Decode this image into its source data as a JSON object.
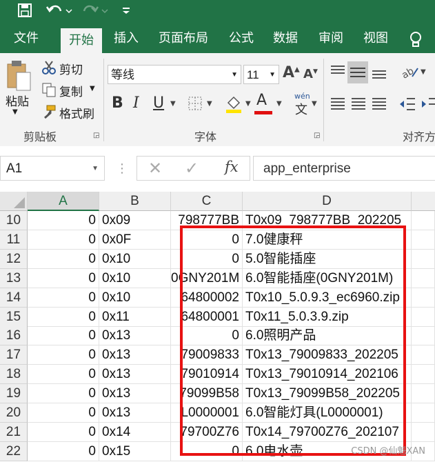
{
  "qat": {
    "save_icon": "save-icon",
    "undo_icon": "undo-icon",
    "redo_icon": "redo-icon"
  },
  "tabs": [
    "文件",
    "开始",
    "插入",
    "页面布局",
    "公式",
    "数据",
    "审阅",
    "视图"
  ],
  "active_tab": "开始",
  "ribbon": {
    "paste": "粘贴",
    "cut": "剪切",
    "copy": "复制",
    "format_painter": "格式刷",
    "clipboard_group": "剪贴板",
    "font_name": "等线",
    "font_size": "11",
    "font_group": "字体",
    "align_group": "对齐方",
    "phonetic": "wén"
  },
  "formula_bar": {
    "name_box": "A1",
    "formula": "app_enterprise",
    "fx": "fx"
  },
  "columns": [
    "A",
    "B",
    "C",
    "D"
  ],
  "rows": [
    {
      "n": "10",
      "a": "0",
      "b": "0x09",
      "c": "798777BB",
      "d": "T0x09_798777BB_202205"
    },
    {
      "n": "11",
      "a": "0",
      "b": "0x0F",
      "c": "0",
      "d": "7.0健康秤"
    },
    {
      "n": "12",
      "a": "0",
      "b": "0x10",
      "c": "0",
      "d": "5.0智能插座"
    },
    {
      "n": "13",
      "a": "0",
      "b": "0x10",
      "c": "0GNY201M",
      "d": "6.0智能插座(0GNY201M)"
    },
    {
      "n": "14",
      "a": "0",
      "b": "0x10",
      "c": "64800002",
      "d": "T0x10_5.0.9.3_ec6960.zip"
    },
    {
      "n": "15",
      "a": "0",
      "b": "0x11",
      "c": "64800001",
      "d": "T0x11_5.0.3.9.zip"
    },
    {
      "n": "16",
      "a": "0",
      "b": "0x13",
      "c": "0",
      "d": "6.0照明产品"
    },
    {
      "n": "17",
      "a": "0",
      "b": "0x13",
      "c": "79009833",
      "d": "T0x13_79009833_202205"
    },
    {
      "n": "18",
      "a": "0",
      "b": "0x13",
      "c": "79010914",
      "d": "T0x13_79010914_202106"
    },
    {
      "n": "19",
      "a": "0",
      "b": "0x13",
      "c": "79099B58",
      "d": "T0x13_79099B58_202205"
    },
    {
      "n": "20",
      "a": "0",
      "b": "0x13",
      "c": "L0000001",
      "d": "6.0智能灯具(L0000001)"
    },
    {
      "n": "21",
      "a": "0",
      "b": "0x14",
      "c": "79700Z76",
      "d": "T0x14_79700Z76_202107"
    },
    {
      "n": "22",
      "a": "0",
      "b": "0x15",
      "c": "0",
      "d": "6.0电水壶"
    }
  ],
  "watermark": "CSDN @仙魁XAN",
  "colors": {
    "excel_green": "#217346",
    "highlight_box": "#e81212"
  }
}
